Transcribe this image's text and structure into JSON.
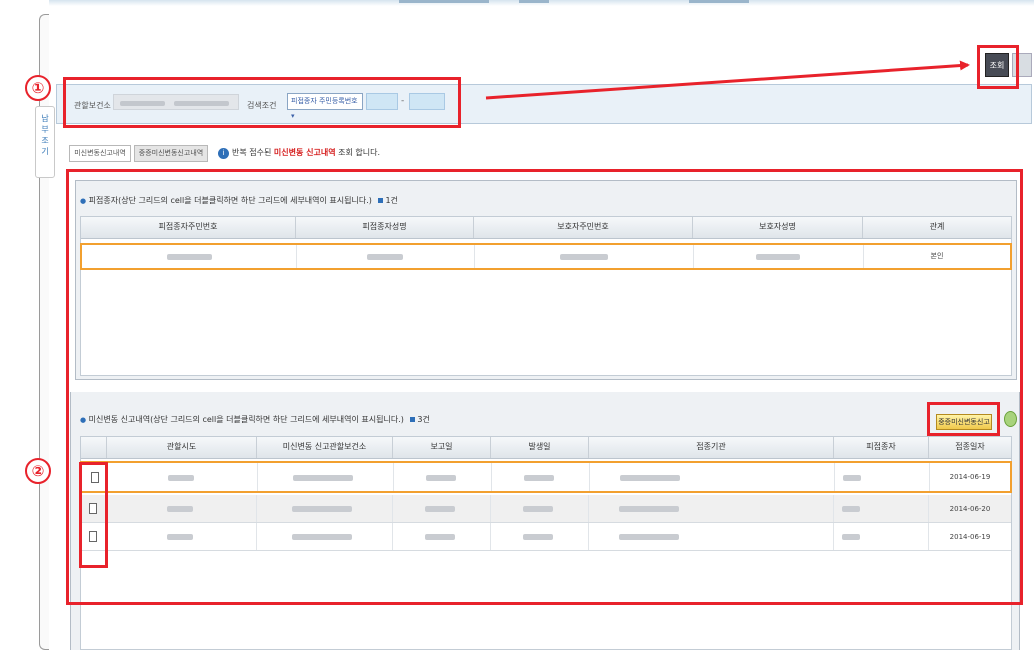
{
  "header": {
    "search_button_label": "조회"
  },
  "side_tab": {
    "chars": [
      "납",
      "부",
      "조",
      "기"
    ]
  },
  "search_bar": {
    "health_center_label": "관할보건소",
    "condition_label": "검색조건",
    "condition_select": "피접종자 주민등록번호 ▾"
  },
  "tabs": [
    {
      "label": "미신변동신고내역"
    },
    {
      "label": "중증미신변동신고내역"
    }
  ],
  "notice": {
    "prefix": "반복 접수된",
    "highlight": "미신변동 신고내역",
    "suffix": "조회 합니다."
  },
  "top_section": {
    "title": "피접종자(상단 그리드의 cell을 더블클릭하면 하단 그리드에 세부내역이 표시됩니다.)",
    "count": "1건",
    "columns": [
      "피접종자주민번호",
      "피접종자성명",
      "보호자주민번호",
      "보호자성명",
      "관계"
    ],
    "rows": [
      {
        "cells": [
          "",
          "",
          "",
          "",
          "본인"
        ]
      }
    ]
  },
  "bottom_section": {
    "title": "미신변동 신고내역(상단 그리드의 cell을 더블클릭하면 하단 그리드에 세부내역이 표시됩니다.)",
    "count": "3건",
    "register_button": "중증미신변동신고",
    "columns": [
      "",
      "관할시도",
      "미신변동 신고관할보건소",
      "보고일",
      "발생일",
      "접종기관",
      "피접종자",
      "접종일자"
    ],
    "rows": [
      {
        "date": "2014-06-19"
      },
      {
        "date": "2014-06-20"
      },
      {
        "date": "2014-06-19"
      }
    ]
  },
  "annotations": {
    "label_1": "①",
    "label_2": "②"
  },
  "colors": {
    "annotation_red": "#e8222b",
    "highlight_orange": "#f2a02f",
    "accent_blue": "#2e6fb8"
  }
}
